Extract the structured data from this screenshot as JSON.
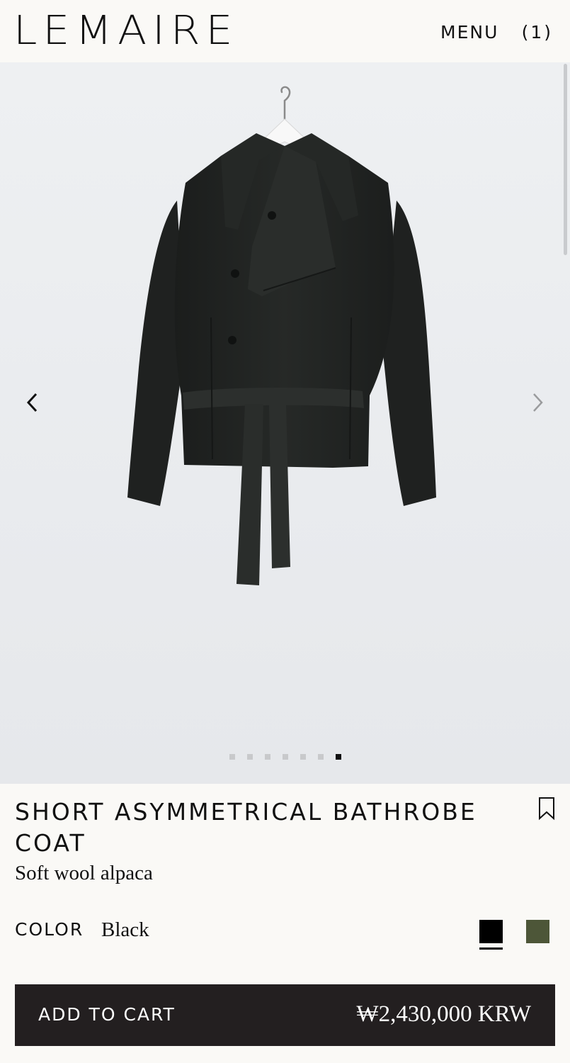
{
  "header": {
    "logo": "LEMAIRE",
    "menu_label": "MENU",
    "cart_count": "(1)"
  },
  "gallery": {
    "prev_icon": "chevron-left-icon",
    "next_icon": "chevron-right-icon",
    "slide_count": 7,
    "active_slide": 7
  },
  "product": {
    "title": "SHORT ASYMMETRICAL BATHROBE COAT",
    "subtitle": "Soft wool alpaca",
    "color_label": "COLOR",
    "color_value": "Black",
    "swatches": [
      {
        "name": "Black",
        "color": "#000000",
        "selected": true
      },
      {
        "name": "Olive",
        "color": "#4d5638",
        "selected": false
      }
    ]
  },
  "cart": {
    "label": "ADD TO CART",
    "price": "₩2,430,000 KRW"
  },
  "colors": {
    "background": "#faf9f6",
    "cart_bar": "#231f20",
    "coat": "#1f2220"
  }
}
